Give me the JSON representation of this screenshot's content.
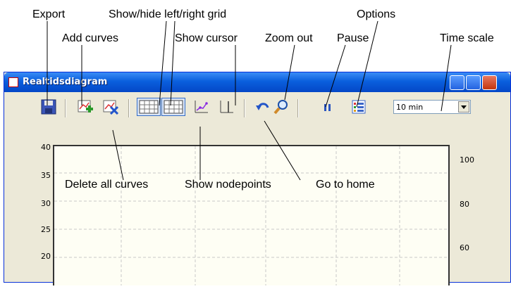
{
  "window": {
    "title": "Realtidsdiagram"
  },
  "callouts": {
    "export": "Export",
    "add_curves": "Add curves",
    "show_hide_grid": "Show/hide left/right grid",
    "show_cursor": "Show cursor",
    "zoom_out": "Zoom out",
    "options": "Options",
    "pause": "Pause",
    "time_scale": "Time scale",
    "delete_all_curves": "Delete all curves",
    "show_nodepoints": "Show nodepoints",
    "go_to_home": "Go to home"
  },
  "toolbar": {
    "time_scale_value": "10 min"
  },
  "axes": {
    "left_ticks": [
      "40",
      "35",
      "30",
      "25",
      "20"
    ],
    "right_ticks": [
      "100",
      "80",
      "60"
    ]
  },
  "colors": {
    "titlebar": "#0a5fdd",
    "toolbar_bg": "#ece9d8",
    "plot_bg": "#fefef4",
    "grid": "#c8c8c8"
  }
}
